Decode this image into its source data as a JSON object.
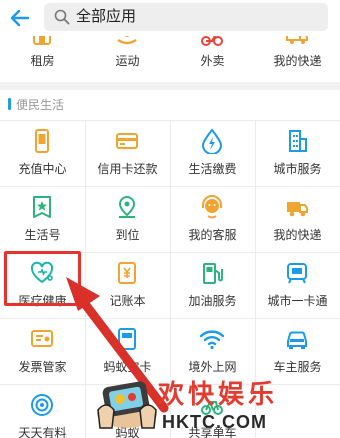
{
  "search": {
    "text": "全部应用"
  },
  "top_row": [
    {
      "label": "租房",
      "icon": "house-icon",
      "color": "#f0a532"
    },
    {
      "label": "运动",
      "icon": "sport-icon",
      "color": "#f0a532"
    },
    {
      "label": "外卖",
      "icon": "bike-icon",
      "color": "#e8443a"
    },
    {
      "label": "我的快递",
      "icon": "truck-icon",
      "color": "#f0a532"
    }
  ],
  "section": {
    "title": "便民生活"
  },
  "apps": [
    {
      "label": "充值中心",
      "icon": "phone-icon",
      "color": "#f0a532"
    },
    {
      "label": "信用卡还款",
      "icon": "credit-card-icon",
      "color": "#f0a532"
    },
    {
      "label": "生活缴费",
      "icon": "water-drop-icon",
      "color": "#1e9be8"
    },
    {
      "label": "城市服务",
      "icon": "building-icon",
      "color": "#1e9be8"
    },
    {
      "label": "生活号",
      "icon": "star-badge-icon",
      "color": "#2db37e"
    },
    {
      "label": "到位",
      "icon": "location-icon",
      "color": "#2db37e"
    },
    {
      "label": "我的客服",
      "icon": "headset-icon",
      "color": "#f0a532"
    },
    {
      "label": "我的快递",
      "icon": "truck-icon",
      "color": "#f0a532"
    },
    {
      "label": "医疗健康",
      "icon": "stethoscope-icon",
      "color": "#1ab7a8"
    },
    {
      "label": "记账本",
      "icon": "ledger-icon",
      "color": "#f0a532"
    },
    {
      "label": "加油服务",
      "icon": "fuel-pump-icon",
      "color": "#2db37e"
    },
    {
      "label": "城市一卡通",
      "icon": "transit-card-icon",
      "color": "#1e9be8"
    },
    {
      "label": "发票管家",
      "icon": "invoice-icon",
      "color": "#f0a532"
    },
    {
      "label": "蚂蚁宝卡",
      "icon": "card-icon",
      "color": "#1e9be8"
    },
    {
      "label": "境外上网",
      "icon": "wifi-icon",
      "color": "#1e9be8"
    },
    {
      "label": "车主服务",
      "icon": "car-icon",
      "color": "#1e9be8"
    },
    {
      "label": "天天有料",
      "icon": "eye-icon",
      "color": "#1e9be8"
    },
    {
      "label": "蚂蚁",
      "icon": "ant-icon",
      "color": "#1e9be8"
    },
    {
      "label": "共享单车",
      "icon": "bike-share-icon",
      "color": "#2db37e"
    },
    {
      "label": "",
      "icon": "",
      "color": "#ffffff"
    }
  ],
  "watermark": {
    "title": "欢快娱乐",
    "url": "HKTC.COM"
  },
  "colors": {
    "accent": "#1e9be8",
    "highlight": "#e8322d"
  }
}
